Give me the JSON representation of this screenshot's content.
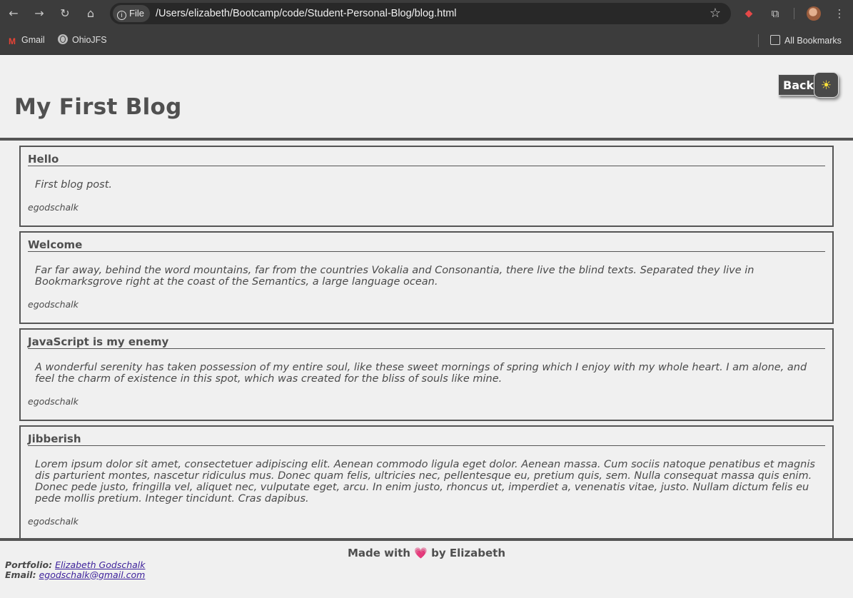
{
  "browser": {
    "url": "/Users/elizabeth/Bootcamp/code/Student-Personal-Blog/blog.html",
    "file_chip": "File",
    "bookmarks": [
      {
        "label": "Gmail",
        "icon": "gmail-icon"
      },
      {
        "label": "OhioJFS",
        "icon": "globe-icon"
      }
    ],
    "all_bookmarks": "All Bookmarks"
  },
  "header": {
    "title": "My First Blog",
    "back_label": "Back",
    "mode_icon": "☀"
  },
  "posts": [
    {
      "title": "Hello",
      "content": "First blog post.",
      "author": "egodschalk"
    },
    {
      "title": "Welcome",
      "content": "Far far away, behind the word mountains, far from the countries Vokalia and Consonantia, there live the blind texts. Separated they live in Bookmarksgrove right at the coast of the Semantics, a large language ocean.",
      "author": "egodschalk"
    },
    {
      "title": "JavaScript is my enemy",
      "content": "A wonderful serenity has taken possession of my entire soul, like these sweet mornings of spring which I enjoy with my whole heart. I am alone, and feel the charm of existence in this spot, which was created for the bliss of souls like mine.",
      "author": "egodschalk"
    },
    {
      "title": "Jibberish",
      "content": "Lorem ipsum dolor sit amet, consectetuer adipiscing elit. Aenean commodo ligula eget dolor. Aenean massa. Cum sociis natoque penatibus et magnis dis parturient montes, nascetur ridiculus mus. Donec quam felis, ultricies nec, pellentesque eu, pretium quis, sem. Nulla consequat massa quis enim. Donec pede justo, fringilla vel, aliquet nec, vulputate eget, arcu. In enim justo, rhoncus ut, imperdiet a, venenatis vitae, justo. Nullam dictum felis eu pede mollis pretium. Integer tincidunt. Cras dapibus.",
      "author": "egodschalk"
    }
  ],
  "footer": {
    "made_with_prefix": "Made with",
    "heart": "💗",
    "made_with_suffix": "by Elizabeth",
    "portfolio_label": "Portfolio:",
    "portfolio_link": "Elizabeth Godschalk",
    "email_label": "Email:",
    "email_link": "egodschalk@gmail.com"
  }
}
